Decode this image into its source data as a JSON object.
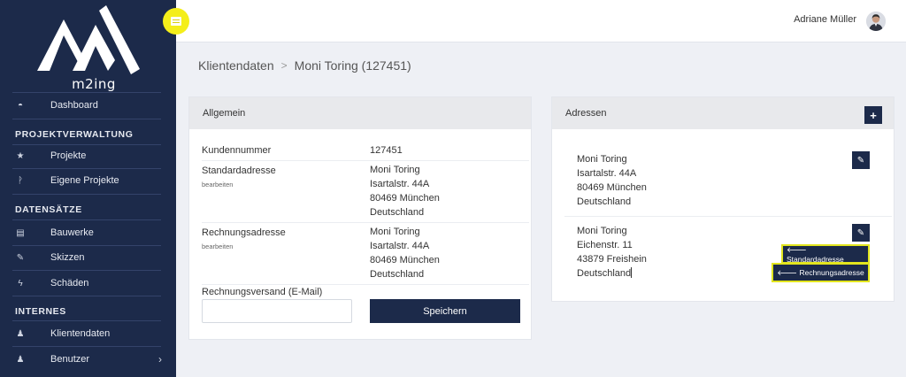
{
  "brand": {
    "name": "m2ing"
  },
  "sidebar": {
    "items": [
      {
        "label": "Dashboard",
        "icon": "gauge-icon"
      },
      {
        "label": "Projekte",
        "icon": "star-icon"
      },
      {
        "label": "Eigene Projekte",
        "icon": "project-icon"
      },
      {
        "label": "Bauwerke",
        "icon": "building-icon"
      },
      {
        "label": "Skizzen",
        "icon": "edit-icon"
      },
      {
        "label": "Schäden",
        "icon": "bolt-icon"
      },
      {
        "label": "Klientendaten",
        "icon": "person-icon"
      },
      {
        "label": "Benutzer",
        "icon": "person-icon"
      }
    ],
    "headings": [
      "PROJEKTVERWALTUNG",
      "DATENSÄTZE",
      "INTERNES"
    ],
    "benutzer_chevron": "›"
  },
  "topbar": {
    "user_name": "Adriane Müller",
    "accent": "#f4ee1a"
  },
  "breadcrumb": {
    "parent": "Klientendaten",
    "separator": ">",
    "current": "Moni Toring (127451)"
  },
  "allgemein": {
    "title": "Allgemein",
    "kundennummer_label": "Kundennummer",
    "kundennummer_value": "127451",
    "standard_label": "Standardadresse",
    "standard_sub": "bearbeiten",
    "standard_lines": [
      "Moni Toring",
      "Isartalstr. 44A",
      "80469 München",
      "Deutschland"
    ],
    "rechnung_label": "Rechnungsadresse",
    "rechnung_sub": "bearbeiten",
    "rechnung_lines": [
      "Moni Toring",
      "Isartalstr. 44A",
      "80469 München",
      "Deutschland"
    ],
    "versand_label": "Rechnungsversand (E-Mail)",
    "versand_value": "",
    "save_label": "Speichern"
  },
  "adressen": {
    "title": "Adressen",
    "add_label": "+",
    "address1": [
      "Moni Toring",
      "Isartalstr. 44A",
      "80469 München",
      "Deutschland"
    ],
    "address2": [
      "Moni Toring",
      "Eichenstr. 11",
      "43879 Freishein",
      "Deutschland"
    ],
    "set_default_label": "🡐 Standardadresse",
    "set_billing_label": "🡐 Rechnungsadresse"
  },
  "colors": {
    "navy": "#1c2a4a",
    "highlight": "#e2e51e"
  }
}
